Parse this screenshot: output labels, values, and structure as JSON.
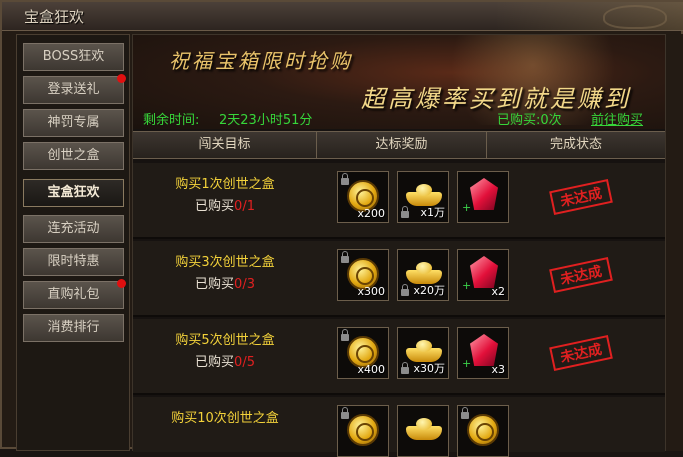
{
  "window": {
    "title": "宝盒狂欢"
  },
  "sidebar": {
    "items": [
      {
        "label": "BOSS狂欢",
        "dot": false,
        "active": false
      },
      {
        "label": "登录送礼",
        "dot": true,
        "active": false
      },
      {
        "label": "神罚专属",
        "dot": false,
        "active": false
      },
      {
        "label": "创世之盒",
        "dot": false,
        "active": false
      },
      {
        "label": "宝盒狂欢",
        "dot": false,
        "active": true
      },
      {
        "label": "连充活动",
        "dot": false,
        "active": false
      },
      {
        "label": "限时特惠",
        "dot": false,
        "active": false
      },
      {
        "label": "直购礼包",
        "dot": true,
        "active": false
      },
      {
        "label": "消费排行",
        "dot": false,
        "active": false
      }
    ]
  },
  "banner": {
    "line1": "祝福宝箱限时抢购",
    "line2": "超高爆率买到就是赚到",
    "timer_label": "剩余时间:",
    "timer_value": "2天23小时51分",
    "bought": "已购买:0次",
    "go_link": "前往购买"
  },
  "table": {
    "headers": [
      "闯关目标",
      "达标奖励",
      "完成状态"
    ],
    "rows": [
      {
        "goal": "购买1次创世之盒",
        "progress_label": "已购买",
        "progress": "0/1",
        "rewards": [
          "x200",
          "x1万",
          ""
        ],
        "status": "未达成"
      },
      {
        "goal": "购买3次创世之盒",
        "progress_label": "已购买",
        "progress": "0/3",
        "rewards": [
          "x300",
          "x20万",
          "x2"
        ],
        "status": "未达成"
      },
      {
        "goal": "购买5次创世之盒",
        "progress_label": "已购买",
        "progress": "0/5",
        "rewards": [
          "x400",
          "x30万",
          "x3"
        ],
        "status": "未达成"
      },
      {
        "goal": "购买10次创世之盒",
        "progress_label": "",
        "progress": "",
        "rewards": [
          "",
          "",
          ""
        ],
        "status": ""
      }
    ]
  },
  "icons": {
    "reward_types": [
      "gold-coin-icon",
      "gold-ingot-icon",
      "red-crystal-icon"
    ]
  },
  "colors": {
    "timer_green": "#37d63a",
    "goal_yellow": "#f3d23a",
    "status_red": "#e02020"
  }
}
